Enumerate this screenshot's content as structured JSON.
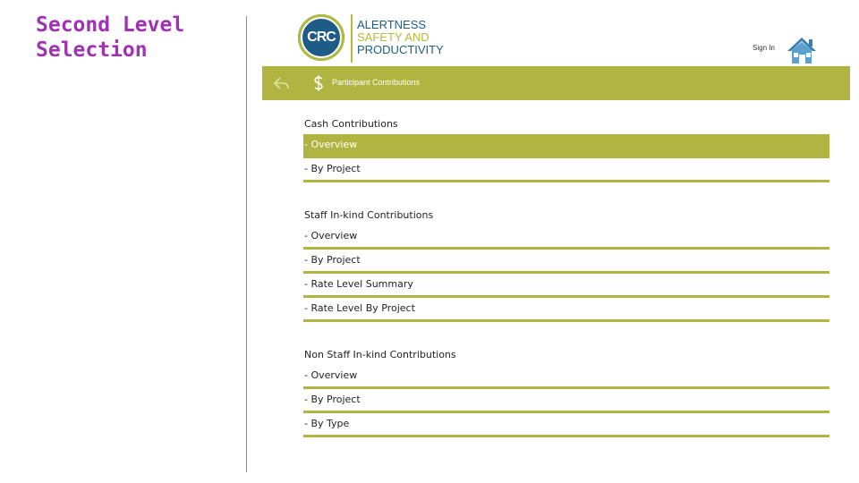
{
  "slide_title": "Second Level Selection",
  "header": {
    "logo_abbr": "CRC",
    "logo_line1": "ALERTNESS",
    "logo_line2": "SAFETY AND",
    "logo_line3": "PRODUCTIVITY",
    "sign_in": "Sign In",
    "home_icon": "home-icon"
  },
  "toolbar": {
    "back_icon": "back-arrow-icon",
    "section_icon": "dollar-icon",
    "title": "Participant Contributions"
  },
  "groups": [
    {
      "heading": "Cash Contributions",
      "items": [
        "- Overview",
        "- By Project"
      ],
      "selected_index": 0
    },
    {
      "heading": "Staff In-kind Contributions",
      "items": [
        "- Overview",
        "- By Project",
        "- Rate Level Summary",
        "- Rate Level By Project"
      ],
      "selected_index": -1
    },
    {
      "heading": "Non Staff In-kind Contributions",
      "items": [
        "- Overview",
        "- By Project",
        "- By Type"
      ],
      "selected_index": -1
    }
  ],
  "colors": {
    "accent": "#b0b441",
    "brand_blue": "#1f5c85",
    "slide_title": "#a030b4"
  }
}
